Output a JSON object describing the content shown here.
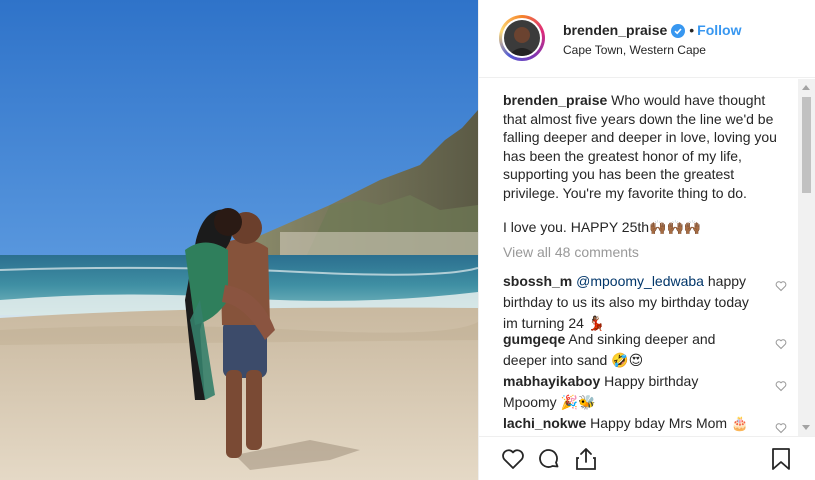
{
  "header": {
    "username": "brenden_praise",
    "separator": "•",
    "follow_label": "Follow",
    "location": "Cape Town, Western Cape"
  },
  "caption": {
    "username": "brenden_praise",
    "text": "Who would have thought that almost five years down the line we'd be falling deeper and deeper in love, loving you has been the greatest honor of my life, supporting you has been the greatest privilege. You're my favorite thing to do.",
    "text2": "I love you. HAPPY 25th",
    "emoji2": "🙌🏾🙌🏾🙌🏾"
  },
  "view_all_label": "View all 48 comments",
  "comments": [
    {
      "username": "sbossh_m",
      "mention": "@mpoomy_ledwaba",
      "text": "happy birthday to us its also my birthday today im turning 24",
      "emoji": "💃🏾"
    },
    {
      "username": "gumgeqe",
      "mention": "",
      "text": "And sinking deeper and deeper into sand",
      "emoji": "🤣😍"
    },
    {
      "username": "mabhayikaboy",
      "mention": "",
      "text": "Happy birthday Mpoomy",
      "emoji": "🎉🐝"
    },
    {
      "username": "lachi_nokwe",
      "mention": "",
      "text": "Happy bday Mrs Mom",
      "emoji": "🎂"
    }
  ],
  "icons": {
    "verified": "verified-badge-icon",
    "like": "heart-icon",
    "comment": "comment-bubble-icon",
    "share": "share-icon",
    "save": "bookmark-icon"
  },
  "colors": {
    "link_blue": "#3897f0",
    "text": "#262626",
    "muted": "#999999"
  }
}
